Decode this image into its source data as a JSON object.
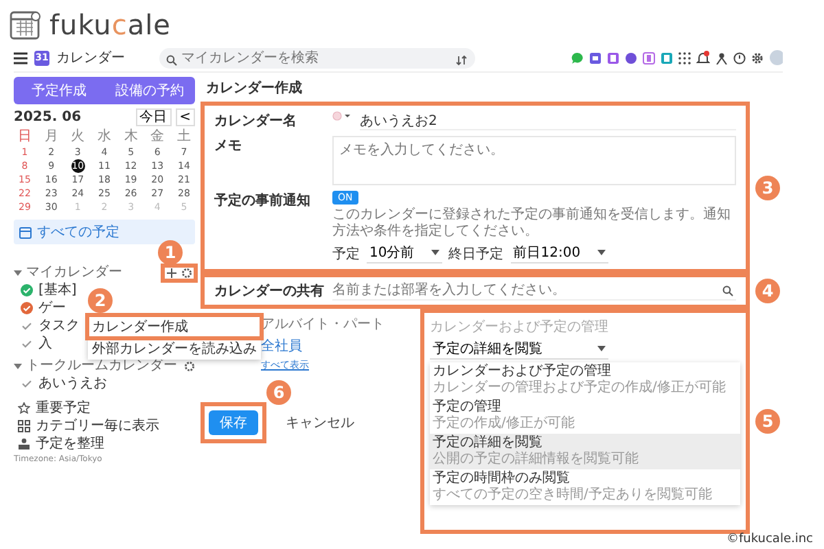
{
  "brand": {
    "parts": [
      {
        "text": "fuku",
        "accent": false
      },
      {
        "text": "c",
        "accent": true
      },
      {
        "text": "ale",
        "accent": false
      }
    ]
  },
  "app_header": {
    "icon_text": "31",
    "title": "カレンダー",
    "search_placeholder": "マイカレンダーを検索"
  },
  "sidebar": {
    "buttons": [
      "予定作成",
      "設備の予約"
    ],
    "calendar": {
      "month": "2025. 06",
      "today": "今日",
      "prev": "<",
      "weekdays": [
        "日",
        "月",
        "火",
        "水",
        "木",
        "金",
        "土"
      ],
      "days": [
        {
          "day": "1",
          "selected": false,
          "outside": false
        },
        {
          "day": "2",
          "selected": false,
          "outside": false
        },
        {
          "day": "3",
          "selected": false,
          "outside": false
        },
        {
          "day": "4",
          "selected": false,
          "outside": false
        },
        {
          "day": "5",
          "selected": false,
          "outside": false
        },
        {
          "day": "6",
          "selected": false,
          "outside": false
        },
        {
          "day": "7",
          "selected": false,
          "outside": false
        },
        {
          "day": "8",
          "selected": false,
          "outside": false
        },
        {
          "day": "9",
          "selected": false,
          "outside": false
        },
        {
          "day": "10",
          "selected": true,
          "outside": false
        },
        {
          "day": "11",
          "selected": false,
          "outside": false
        },
        {
          "day": "12",
          "selected": false,
          "outside": false
        },
        {
          "day": "13",
          "selected": false,
          "outside": false
        },
        {
          "day": "14",
          "selected": false,
          "outside": false
        },
        {
          "day": "15",
          "selected": false,
          "outside": false
        },
        {
          "day": "16",
          "selected": false,
          "outside": false
        },
        {
          "day": "17",
          "selected": false,
          "outside": false
        },
        {
          "day": "18",
          "selected": false,
          "outside": false
        },
        {
          "day": "19",
          "selected": false,
          "outside": false
        },
        {
          "day": "20",
          "selected": false,
          "outside": false
        },
        {
          "day": "21",
          "selected": false,
          "outside": false
        },
        {
          "day": "22",
          "selected": false,
          "outside": false
        },
        {
          "day": "23",
          "selected": false,
          "outside": false
        },
        {
          "day": "24",
          "selected": false,
          "outside": false
        },
        {
          "day": "25",
          "selected": false,
          "outside": false
        },
        {
          "day": "26",
          "selected": false,
          "outside": false
        },
        {
          "day": "27",
          "selected": false,
          "outside": false
        },
        {
          "day": "28",
          "selected": false,
          "outside": false
        },
        {
          "day": "29",
          "selected": false,
          "outside": false
        },
        {
          "day": "30",
          "selected": false,
          "outside": false
        },
        {
          "day": "1",
          "selected": false,
          "outside": true
        },
        {
          "day": "2",
          "selected": false,
          "outside": true
        },
        {
          "day": "3",
          "selected": false,
          "outside": true
        },
        {
          "day": "4",
          "selected": false,
          "outside": true
        },
        {
          "day": "5",
          "selected": false,
          "outside": true
        }
      ]
    },
    "all_events": {
      "label": "すべての予定",
      "selected": true
    },
    "my_calendars": {
      "label": "マイカレンダー",
      "callout": "1",
      "items": [
        {
          "label": "[基本]",
          "checked": true,
          "color": "#2bb36b"
        },
        {
          "label": "ゲー",
          "checked": true,
          "color": "#e2683c"
        },
        {
          "label": "タスク",
          "checked": false
        },
        {
          "label": "入",
          "checked": false
        }
      ]
    },
    "context_menu": {
      "callout": "2",
      "items": [
        {
          "label": "カレンダー作成",
          "callout_box": true
        },
        {
          "label": "外部カレンダーを読み込み",
          "callout_box": false
        }
      ]
    },
    "talk_calendars": {
      "label": "トークルームカレンダー",
      "items": [
        {
          "label": "あいうえお",
          "checked": false
        }
      ]
    },
    "links": [
      "重要予定",
      "カテゴリー毎に表示",
      "予定を整理"
    ],
    "timezone": "Timezone: Asia/Tokyo"
  },
  "main": {
    "title": "カレンダー作成",
    "form": {
      "callout": "3",
      "name_label": "カレンダー名",
      "name_value": "あいうえお2",
      "memo_label": "メモ",
      "memo_placeholder": "メモを入力してください。",
      "notify_label": "予定の事前通知",
      "toggle_text": "ON",
      "notify_on": true,
      "notify_description": "このカレンダーに登録された予定の事前通知を受信します。通知方法や条件を指定してください。",
      "selects": [
        {
          "label": "予定",
          "value": "10分前"
        },
        {
          "label": "終日予定",
          "value": "前日12:00"
        }
      ]
    },
    "share": {
      "callout": "4",
      "label": "カレンダーの共有",
      "placeholder": "名前または部署を入力してください。"
    },
    "members": [
      {
        "name": "アルバイト・パート",
        "link": false
      },
      {
        "name": "全社員",
        "link": true
      }
    ],
    "more_link": "すべて表示",
    "permission": {
      "callout": "5",
      "header": "カレンダーおよび予定の管理",
      "value": "予定の詳細を閲覧",
      "options": [
        {
          "title": "カレンダーおよび予定の管理",
          "description": "カレンダーの管理および予定の作成/修正が可能",
          "selected": false
        },
        {
          "title": "予定の管理",
          "description": "予定の作成/修正が可能",
          "selected": false
        },
        {
          "title": "予定の詳細を閲覧",
          "description": "公開の予定の詳細情報を閲覧可能",
          "selected": true
        },
        {
          "title": "予定の時間枠のみ閲覧",
          "description": "すべての予定の空き時間/予定ありを閲覧可能",
          "selected": false
        }
      ]
    },
    "save": {
      "label": "保存",
      "callout": "6"
    },
    "cancel": "キャンセル"
  },
  "copyright": "©fukucale.inc"
}
